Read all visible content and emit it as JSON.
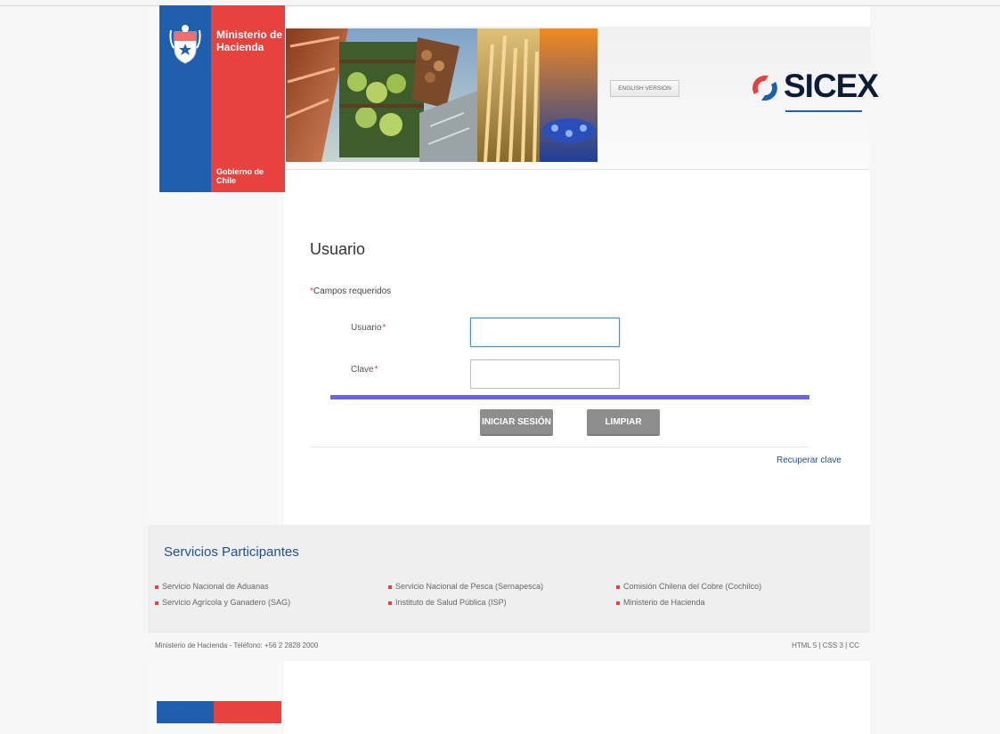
{
  "government_logo": {
    "title": "Ministerio de\nHacienda",
    "subtitle": "Gobierno de Chile"
  },
  "header": {
    "english_button": "ENGLISH VERSION",
    "brand_name": "SICEX"
  },
  "login_form": {
    "title": "Usuario",
    "required_marker": "*",
    "required_note": "Campos requeridos",
    "username_label": "Usuario",
    "username_value": "",
    "password_label": "Clave",
    "password_value": "",
    "login_button": "INICIAR SESIÓN",
    "clear_button": "LIMPIAR",
    "recover_link": "Recuperar clave"
  },
  "services": {
    "title": "Servicios Participantes",
    "items": [
      "Servicio Nacional de Aduanas",
      "Servicio Agrícola y Ganadero (SAG)",
      "Servicio Nacional de Pesca (Sernapesca)",
      "Instituto de Salud Pública (ISP)",
      "Comisión Chilena del Cobre (Cochilco)",
      "Ministerio de Hacienda"
    ]
  },
  "footer": {
    "contact": "Ministerio de Hacienda - Teléfono: +56 2 2828 2000",
    "tech": "HTML 5 | CSS 3 | CC"
  },
  "colors": {
    "chile_blue": "#1f5fae",
    "chile_red": "#e8423f",
    "accent_purple": "#6b63e0",
    "button_gray": "#8d8d8d",
    "link_blue": "#1f4f91"
  },
  "icons": {
    "shield": "coat-of-arms-icon",
    "brand": "sicex-logo-icon"
  }
}
